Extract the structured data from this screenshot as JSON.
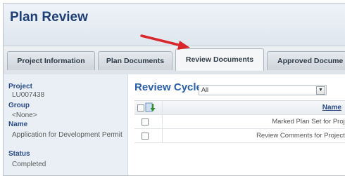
{
  "page": {
    "title": "Plan Review"
  },
  "tabs": [
    {
      "label": "Project Information",
      "active": false
    },
    {
      "label": "Plan Documents",
      "active": false
    },
    {
      "label": "Review Documents",
      "active": true
    },
    {
      "label": "Approved Docume",
      "active": false
    }
  ],
  "sidebar": {
    "project_label": "Project",
    "project_value": "LU007438",
    "group_label": "Group",
    "group_value": "<None>",
    "name_label": "Name",
    "name_value": "Application for Development Permit",
    "status_label": "Status",
    "status_value": "Completed"
  },
  "review_cycle": {
    "title": "Review Cycle",
    "selected": "All",
    "dropdown_icon": "chevron-down-icon"
  },
  "grid": {
    "header_name": "Name",
    "rows": [
      {
        "name": "Marked Plan Set for Proje"
      },
      {
        "name": "Review Comments for Project I"
      }
    ]
  },
  "colors": {
    "title": "#1f3f75",
    "accent_blue": "#2a5ea8",
    "annotation_arrow": "#d9262a",
    "sidebar_bg": "#e9eff5"
  },
  "annotation": {
    "icon": "red-arrow-icon"
  }
}
